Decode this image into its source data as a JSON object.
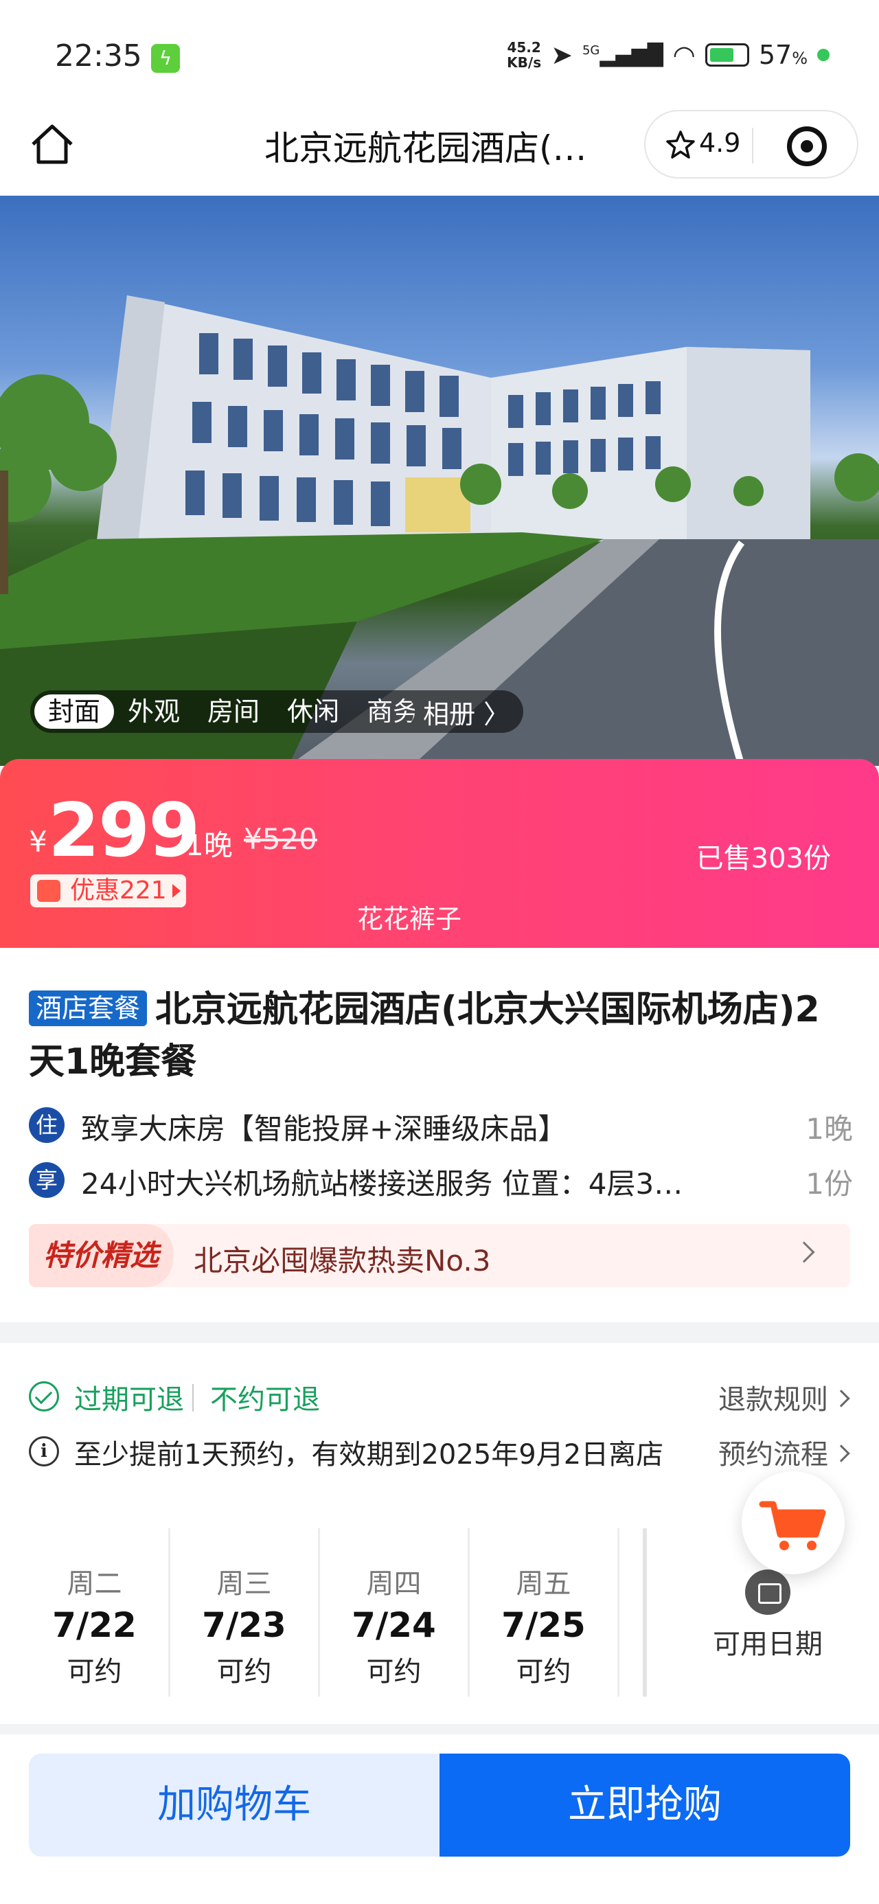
{
  "status_bar": {
    "time": "22:35",
    "net_speed_value": "45.2",
    "net_speed_unit": "KB/s",
    "network": "5G",
    "battery": "57",
    "battery_unit": "%"
  },
  "nav": {
    "title": "北京远航花园酒店(…",
    "rating": "4.9"
  },
  "album": {
    "tabs": [
      "封面",
      "外观",
      "房间",
      "休闲",
      "商务"
    ],
    "link": "相册"
  },
  "price": {
    "currency": "¥",
    "amount": "299",
    "unit": "1晚",
    "original": "¥520",
    "discount": "优惠221",
    "sold": "已售303份",
    "brand": "花花裤子"
  },
  "product": {
    "tag": "酒店套餐",
    "title": "北京远航花园酒店(北京大兴国际机场店)2天1晚套餐",
    "items": [
      {
        "icon": "住",
        "text": "致享大床房【智能投屏+深睡级床品】",
        "qty": "1晚"
      },
      {
        "icon": "享",
        "text": "24小时大兴机场航站楼接送服务 位置：4层3…",
        "qty": "1份"
      }
    ],
    "promo_badge": "特价精选",
    "promo_text": "北京必囤爆款热卖No.3"
  },
  "booking": {
    "refund_a": "过期可退",
    "refund_b": "不约可退",
    "refund_rules": "退款规则",
    "notice": "至少提前1天预约，有效期到2025年9月2日离店",
    "flow": "预约流程",
    "dates": [
      {
        "weekday": "周二",
        "date": "7/22",
        "status": "可约"
      },
      {
        "weekday": "周三",
        "date": "7/23",
        "status": "可约"
      },
      {
        "weekday": "周四",
        "date": "7/24",
        "status": "可约"
      },
      {
        "weekday": "周五",
        "date": "7/25",
        "status": "可约"
      }
    ],
    "available_dates": "可用日期"
  },
  "actions": {
    "add_cart": "加购物车",
    "buy_now": "立即抢购"
  },
  "colors": {
    "primary_blue": "#0b6bf4",
    "price_gradient_start": "#ff4c52",
    "price_gradient_end": "#ff3a8a",
    "green": "#17a05d"
  }
}
